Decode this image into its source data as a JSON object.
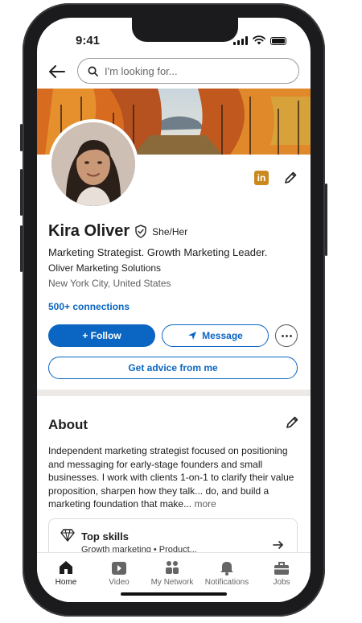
{
  "status": {
    "time": "9:41"
  },
  "search": {
    "placeholder": "I'm looking for..."
  },
  "profile": {
    "name": "Kira Oliver",
    "pronouns": "She/Her",
    "headline": "Marketing Strategist. Growth Marketing Leader.",
    "company": "Oliver Marketing Solutions",
    "location": "New York City, United States",
    "connections": "500+ connections",
    "linkedin_badge": "in"
  },
  "actions": {
    "follow_label": "+ Follow",
    "message_label": "Message",
    "advice_label": "Get advice from me"
  },
  "about": {
    "title": "About",
    "text": "Independent marketing strategist focused on positioning and messaging for early-stage founders and small businesses. I work with clients 1-on-1 to clarify their value proposition, sharpen how they talk... do, and build a marketing foundation that make...",
    "more_label": "more"
  },
  "skills": {
    "title": "Top skills",
    "subtitle": "Growth marketing • Product..."
  },
  "nav": {
    "items": [
      {
        "label": "Home",
        "icon": "home-icon"
      },
      {
        "label": "Video",
        "icon": "video-icon"
      },
      {
        "label": "My Network",
        "icon": "network-icon"
      },
      {
        "label": "Notifications",
        "icon": "bell-icon"
      },
      {
        "label": "Jobs",
        "icon": "briefcase-icon"
      }
    ]
  },
  "colors": {
    "brand_blue": "#0a66c2",
    "linkedin_gold": "#c9891e",
    "divider": "#ece9e6"
  }
}
